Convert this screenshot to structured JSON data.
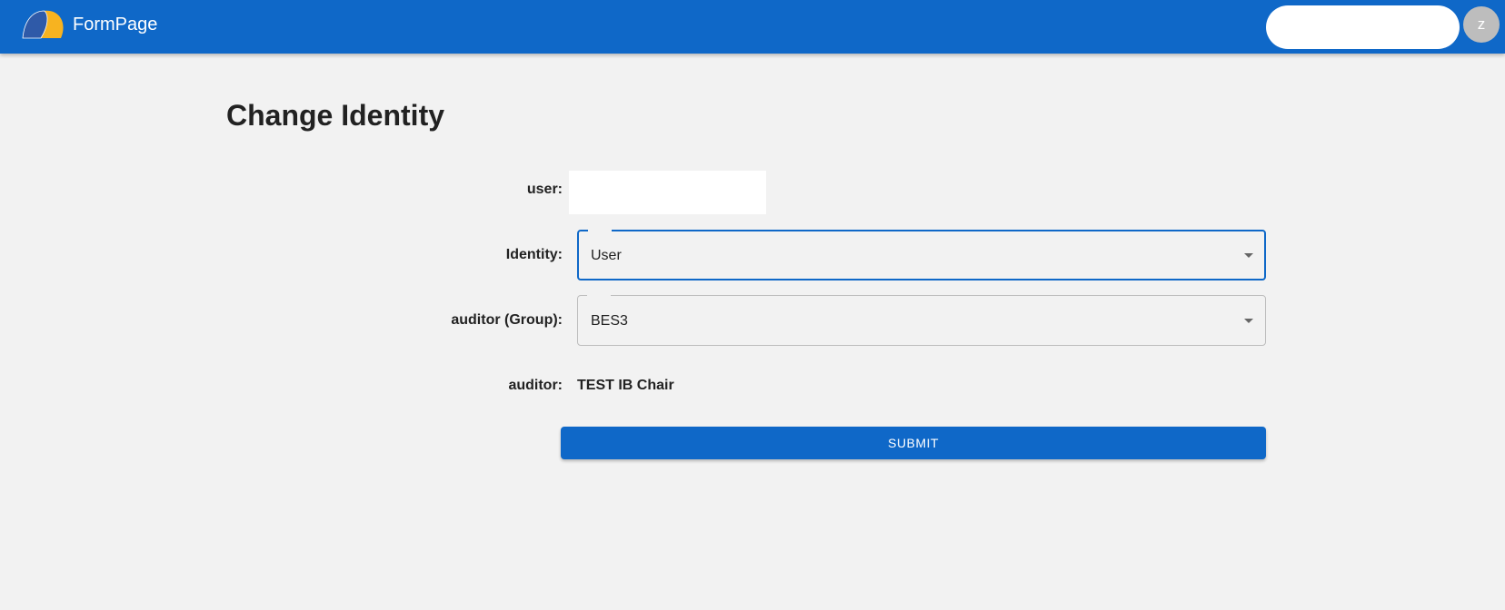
{
  "app": {
    "title": "FormPage",
    "logo_icon": "formpage-logo-icon",
    "brand_color": "#0f68c8",
    "logo_colors": {
      "left": "#2f5aa8",
      "right": "#f7b320"
    }
  },
  "header": {
    "search": {
      "value": "",
      "placeholder": ""
    },
    "avatar_initial": "z"
  },
  "page": {
    "title": "Change Identity"
  },
  "form": {
    "user": {
      "label": "user:",
      "value": ""
    },
    "identity": {
      "label": "Identity:",
      "value": "User"
    },
    "auditor_group": {
      "label": "auditor (Group):",
      "value": "BES3"
    },
    "auditor": {
      "label": "auditor:",
      "value": "TEST IB Chair"
    },
    "submit_label": "Submit"
  }
}
